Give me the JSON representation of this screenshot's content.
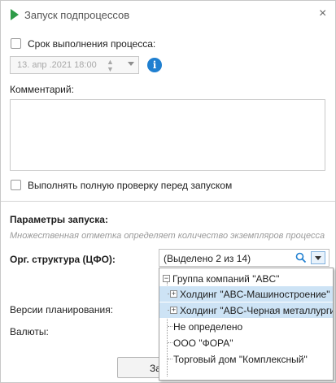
{
  "window": {
    "title": "Запуск подпроцессов",
    "close_glyph": "×"
  },
  "deadline": {
    "label": "Срок выполнения процесса:",
    "checked": false,
    "date_value": "13. апр .2021 18:00"
  },
  "comment": {
    "label": "Комментарий:",
    "value": ""
  },
  "full_check": {
    "label": "Выполнять полную проверку перед запуском",
    "checked": false
  },
  "params": {
    "heading": "Параметры запуска:",
    "hint": "Множественная отметка определяет количество экземпляров процесса",
    "org_label": "Орг. структура (ЦФО):",
    "org_value": "(Выделено 2 из 14)",
    "versions_label": "Версии планирования:",
    "currencies_label": "Валюты:"
  },
  "org_tree": [
    {
      "label": "Группа компаний \"ABC\"",
      "expander": "−",
      "level": 0,
      "selected": false,
      "checked": false
    },
    {
      "label": "Холдинг \"ABC-Машиностроение\"",
      "expander": "+",
      "level": 1,
      "selected": true,
      "checked": true
    },
    {
      "label": "Холдинг \"ABC-Черная металлургия\"",
      "expander": "+",
      "level": 1,
      "selected": true,
      "checked": true
    },
    {
      "label": "Не определено",
      "expander": "",
      "level": 1,
      "selected": false,
      "checked": false
    },
    {
      "label": "ООО \"ФОРА\"",
      "expander": "",
      "level": 1,
      "selected": false,
      "checked": false
    },
    {
      "label": "Торговый дом \"Комплексный\"",
      "expander": "",
      "level": 1,
      "selected": false,
      "checked": false
    }
  ],
  "footer": {
    "button_label": "За"
  },
  "colors": {
    "accent": "#1f7fd0",
    "play": "#2e9b48",
    "selection": "#cde3f5"
  }
}
